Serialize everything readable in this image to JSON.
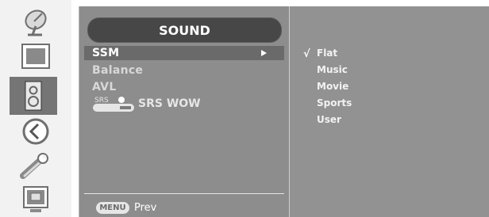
{
  "sidebar": {
    "icons": [
      {
        "name": "satellite-dish-icon"
      },
      {
        "name": "picture-icon"
      },
      {
        "name": "speaker-icon",
        "active": true
      },
      {
        "name": "back-arrow-icon"
      },
      {
        "name": "wrench-icon"
      },
      {
        "name": "pip-screen-icon"
      }
    ]
  },
  "menu": {
    "title": "SOUND",
    "items": [
      {
        "label": "SSM",
        "selected": true
      },
      {
        "label": "Balance"
      },
      {
        "label": "AVL"
      }
    ],
    "srs_badge": "SRS",
    "srs_label": "SRS WOW",
    "footer": {
      "key_label": "MENU",
      "action_label": "Prev"
    }
  },
  "submenu": {
    "check_mark": "√",
    "items": [
      "Flat",
      "Music",
      "Movie",
      "Sports",
      "User"
    ],
    "checked_index": 0
  }
}
